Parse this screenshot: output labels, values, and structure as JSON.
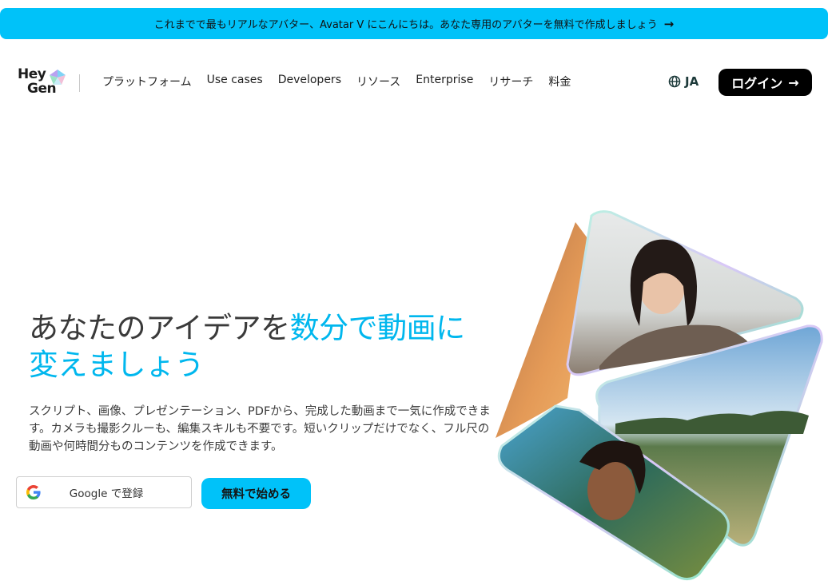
{
  "announcement": {
    "text": "これまでで最もリアルなアバター、Avatar V にこんにちは。あなた専用のアバターを無料で作成しましょう",
    "arrow": "→"
  },
  "logo": {
    "line1": "Hey",
    "line2": "Gen"
  },
  "nav": {
    "items": [
      {
        "label": "プラットフォーム"
      },
      {
        "label": "Use cases"
      },
      {
        "label": "Developers"
      },
      {
        "label": "リソース"
      },
      {
        "label": "Enterprise"
      },
      {
        "label": "リサーチ"
      },
      {
        "label": "料金"
      }
    ],
    "language": "JA",
    "login": "ログイン",
    "login_arrow": "→"
  },
  "hero": {
    "headline_part1": "あなたのアイデアを",
    "headline_highlight1": "数分で動画に",
    "headline_highlight2": "変えましょう",
    "description": "スクリプト、画像、プレゼンテーション、PDFから、完成した動画まで一気に作成できます。カメラも撮影クルーも、編集スキルも不要です。短いクリップだけでなく、フル尺の動画や何時間分ものコンテンツを作成できます。",
    "google_button": "Google で登録",
    "start_button": "無料で始める"
  },
  "colors": {
    "accent": "#00c2f9",
    "headline_accent": "#00b7ee",
    "login_bg": "#000000"
  },
  "icons": {
    "globe": "globe-icon",
    "google": "google-g-icon",
    "arrow": "arrow-right-icon"
  }
}
